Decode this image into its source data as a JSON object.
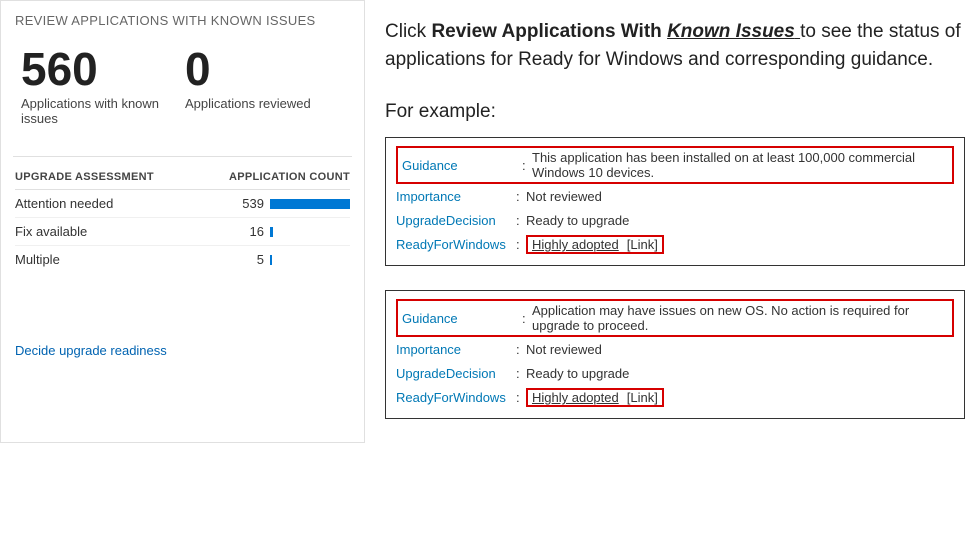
{
  "panel": {
    "title": "REVIEW APPLICATIONS WITH KNOWN ISSUES",
    "stat1_number": "560",
    "stat1_label": "Applications with known issues",
    "stat2_number": "0",
    "stat2_label": "Applications reviewed",
    "table_header_label": "UPGRADE ASSESSMENT",
    "table_header_count": "APPLICATION COUNT",
    "rows": [
      {
        "label": "Attention needed",
        "count": "539",
        "bar_pct": 100
      },
      {
        "label": "Fix available",
        "count": "16",
        "bar_pct": 4
      },
      {
        "label": "Multiple",
        "count": "5",
        "bar_pct": 2
      }
    ],
    "footer_link": "Decide upgrade readiness"
  },
  "instruction": {
    "prefix": "Click ",
    "bold1": "Review Applications With ",
    "underlined": "Known Issues",
    "suffix": "to see the status of applications for Ready for Windows and corresponding guidance."
  },
  "example_label": "For example:",
  "example1": {
    "guidance_key": "Guidance",
    "guidance_val": "This application has been installed on at least 100,000 commercial Windows 10 devices.",
    "importance_key": "Importance",
    "importance_val": "Not reviewed",
    "upgrade_key": "UpgradeDecision",
    "upgrade_val": "Ready to upgrade",
    "ready_key": "ReadyForWindows",
    "ready_val": "Highly adopted",
    "link_text": "[Link]"
  },
  "example2": {
    "guidance_key": "Guidance",
    "guidance_val": "Application may have issues on new OS. No action is required for upgrade to proceed.",
    "importance_key": "Importance",
    "importance_val": "Not reviewed",
    "upgrade_key": "UpgradeDecision",
    "upgrade_val": "Ready to upgrade",
    "ready_key": "ReadyForWindows",
    "ready_val": "Highly adopted",
    "link_text": "[Link]"
  },
  "chart_data": {
    "type": "bar",
    "title": "Upgrade Assessment — Application Count",
    "categories": [
      "Attention needed",
      "Fix available",
      "Multiple"
    ],
    "values": [
      539,
      16,
      5
    ],
    "xlabel": "",
    "ylabel": "Application Count"
  }
}
